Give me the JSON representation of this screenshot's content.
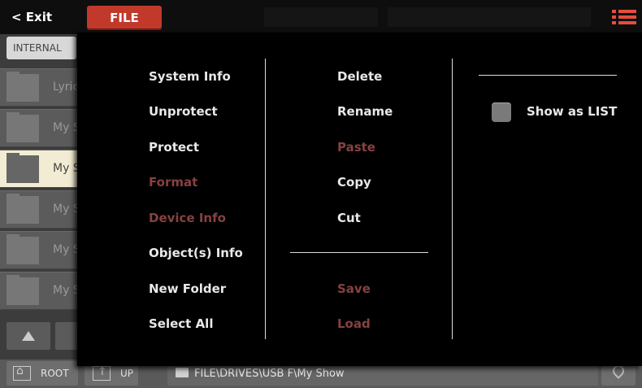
{
  "header": {
    "exit_label": "< Exit",
    "file_tab_label": "FILE",
    "menu_icon": "list-menu-icon",
    "accent_color": "#c0392b"
  },
  "sidebar": {
    "tab_label": "INTERNAL",
    "rows": [
      {
        "label": "Lyric",
        "selected": false
      },
      {
        "label": "My S",
        "selected": false
      },
      {
        "label": "My S",
        "selected": true
      },
      {
        "label": "My S",
        "selected": false
      },
      {
        "label": "My S",
        "selected": false
      },
      {
        "label": "My S",
        "selected": false
      }
    ]
  },
  "bottom": {
    "root_label": "ROOT",
    "up_label": "UP",
    "path": "FILE\\DRIVES\\USB F\\My Show"
  },
  "menu": {
    "col1": [
      {
        "label": "System Info",
        "enabled": true
      },
      {
        "label": "Unprotect",
        "enabled": true
      },
      {
        "label": "Protect",
        "enabled": true
      },
      {
        "label": "Format",
        "enabled": false
      },
      {
        "label": "Device Info",
        "enabled": false
      },
      {
        "label": "Object(s) Info",
        "enabled": true
      },
      {
        "label": "New Folder",
        "enabled": true
      },
      {
        "label": "Select All",
        "enabled": true
      }
    ],
    "col2": [
      {
        "label": "Delete",
        "enabled": true
      },
      {
        "label": "Rename",
        "enabled": true
      },
      {
        "label": "Paste",
        "enabled": false
      },
      {
        "label": "Copy",
        "enabled": true
      },
      {
        "label": "Cut",
        "enabled": true
      }
    ],
    "col2_bottom": [
      {
        "label": "Save",
        "enabled": false
      },
      {
        "label": "Load",
        "enabled": false
      }
    ],
    "show_as_list": {
      "label": "Show as LIST",
      "checked": false
    },
    "disabled_color": "#874141"
  }
}
